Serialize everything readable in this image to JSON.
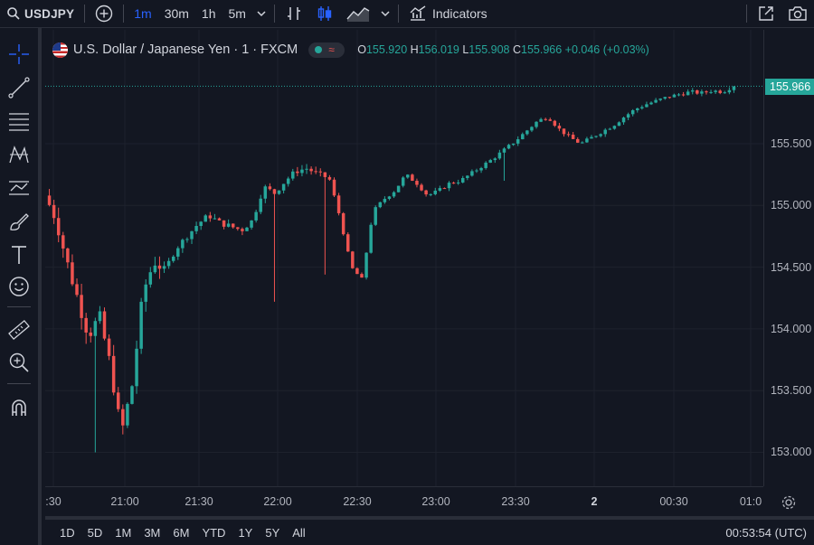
{
  "toolbar": {
    "symbol": "USDJPY",
    "intervals": [
      "1m",
      "30m",
      "1h",
      "5m"
    ],
    "active_interval": "1m",
    "indicators_label": "Indicators"
  },
  "legend": {
    "title": "U.S. Dollar / Japanese Yen · 1 · FXCM",
    "o_label": "O",
    "o": "155.920",
    "h_label": "H",
    "h": "156.019",
    "l_label": "L",
    "l": "155.908",
    "c_label": "C",
    "c": "155.966",
    "change": "+0.046 (+0.03%)"
  },
  "price_axis": {
    "ticks": [
      "155.500",
      "155.000",
      "154.500",
      "154.000",
      "153.500",
      "153.000"
    ],
    "last_price": "155.966"
  },
  "time_axis": {
    "ticks": [
      ":30",
      "21:00",
      "21:30",
      "22:00",
      "22:30",
      "23:00",
      "23:30",
      "2",
      "00:30",
      "01:0"
    ]
  },
  "bottombar": {
    "ranges": [
      "1D",
      "5D",
      "1M",
      "3M",
      "6M",
      "YTD",
      "1Y",
      "5Y",
      "All"
    ],
    "clock": "00:53:54 (UTC)"
  },
  "colors": {
    "up": "#26a69a",
    "down": "#ef5350",
    "accent": "#2962ff",
    "background": "#131722"
  },
  "chart_data": {
    "type": "candlestick",
    "title": "U.S. Dollar / Japanese Yen · 1 · FXCM",
    "x_ticks": [
      ":30",
      "21:00",
      "21:30",
      "22:00",
      "22:30",
      "23:00",
      "23:30",
      "2",
      "00:30",
      "01:0"
    ],
    "y_ticks": [
      155.5,
      155.0,
      154.5,
      154.0,
      153.5,
      153.0
    ],
    "ylim": [
      152.8,
      156.1
    ],
    "close_path": [
      155.08,
      154.9,
      154.55,
      154.25,
      153.95,
      154.1,
      153.7,
      153.15,
      153.55,
      154.3,
      154.55,
      154.48,
      154.65,
      154.75,
      154.85,
      154.92,
      154.86,
      154.83,
      154.8,
      154.88,
      155.15,
      155.1,
      155.2,
      155.28,
      155.3,
      155.25,
      155.22,
      154.9,
      154.5,
      154.4,
      154.95,
      155.05,
      155.12,
      155.25,
      155.18,
      155.08,
      155.12,
      155.18,
      155.2,
      155.26,
      155.32,
      155.38,
      155.45,
      155.52,
      155.6,
      155.68,
      155.72,
      155.62,
      155.55,
      155.5,
      155.55,
      155.6,
      155.65,
      155.72,
      155.78,
      155.82,
      155.85,
      155.88,
      155.9,
      155.92,
      155.91,
      155.93,
      155.92,
      155.97
    ],
    "spikes": [
      {
        "x_frac": 0.33,
        "low": 154.22
      },
      {
        "x_frac": 0.41,
        "low": 154.44
      },
      {
        "x_frac": 0.665,
        "low": 155.2
      },
      {
        "x_frac": 0.075,
        "low": 153.0
      }
    ],
    "last": 155.966,
    "open": 155.92,
    "high": 156.019,
    "low": 155.908,
    "close": 155.966
  }
}
